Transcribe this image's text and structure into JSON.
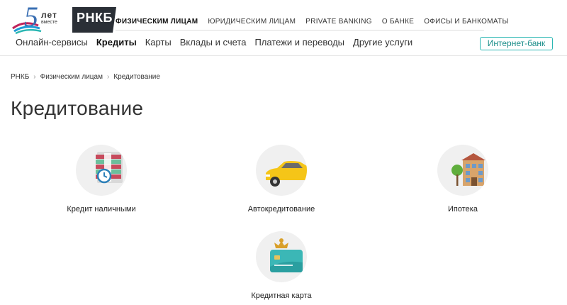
{
  "logo": {
    "years_digit": "5",
    "years_word": "лет",
    "together": "вместе",
    "brand": "РНКБ"
  },
  "top_nav": [
    {
      "label": "ФИЗИЧЕСКИМ ЛИЦАМ",
      "active": true
    },
    {
      "label": "ЮРИДИЧЕСКИМ ЛИЦАМ"
    },
    {
      "label": "PRIVATE BANKING"
    },
    {
      "label": "О БАНКЕ"
    },
    {
      "label": "ОФИСЫ И БАНКОМАТЫ"
    }
  ],
  "main_nav": [
    {
      "label": "Онлайн-сервисы"
    },
    {
      "label": "Кредиты",
      "active": true
    },
    {
      "label": "Карты"
    },
    {
      "label": "Вклады и счета"
    },
    {
      "label": "Платежи и переводы"
    },
    {
      "label": "Другие услуги"
    }
  ],
  "internet_bank": "Интернет-банк",
  "breadcrumb": [
    "РНКБ",
    "Физическим лицам",
    "Кредитование"
  ],
  "breadcrumb_separator": "›",
  "page_title": "Кредитование",
  "products": [
    {
      "label": "Кредит наличными",
      "icon": "cash-clock-icon"
    },
    {
      "label": "Автокредитование",
      "icon": "car-icon"
    },
    {
      "label": "Ипотека",
      "icon": "house-icon"
    },
    {
      "label": "Кредитная карта",
      "icon": "credit-card-icon"
    }
  ],
  "colors": {
    "accent": "#2bb7b3",
    "icon_bg": "#f0f0f0",
    "car": "#f5c518",
    "card": "#3bb7b6"
  }
}
